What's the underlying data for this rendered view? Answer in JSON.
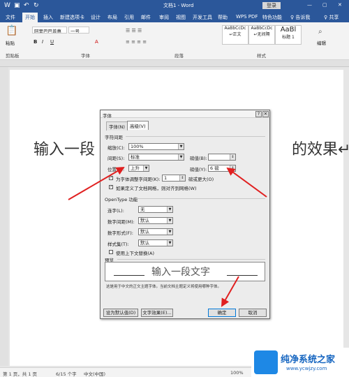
{
  "titlebar": {
    "title": "文档1 - Word",
    "login": "登录",
    "close": "✕",
    "minimize": "—",
    "restore": "▢"
  },
  "tabs": [
    "文件",
    "开始",
    "插入",
    "新建选项卡",
    "设计",
    "布局",
    "引用",
    "邮件",
    "审阅",
    "视图",
    "开发工具",
    "帮助",
    "WPS PDF",
    "特色功能",
    "♀ 告诉我",
    "♀ 共享"
  ],
  "ribbon": {
    "paste": "粘贴",
    "font_name": "阿里巴巴普惠",
    "font_size": "一号",
    "clipboard": "剪贴板",
    "font": "字体",
    "paragraph": "段落",
    "styles": "样式",
    "edit": "编辑",
    "style_items": [
      {
        "preview": "AaBbCcDc",
        "name": "↵正文"
      },
      {
        "preview": "AaBbCcDc",
        "name": "↵无间隔"
      },
      {
        "preview": "AaBl",
        "name": "标题 1"
      }
    ]
  },
  "document": {
    "text_left": "输入一段",
    "text_right": "的效果↵"
  },
  "status": {
    "page": "第 1 页，共 1 页",
    "words": "6/15 个字",
    "lang": "中文(中国)",
    "zoom": "100%"
  },
  "dialog": {
    "title": "字体",
    "help": "?",
    "close": "✕",
    "tab_font": "字体(N)",
    "tab_advanced": "高级(V)",
    "spacing_section": "字符间距",
    "scale_label": "缩放(C):",
    "scale_value": "100%",
    "spacing_label": "间距(S):",
    "spacing_value": "标准",
    "spacing_by_label": "磅值(B):",
    "spacing_by_value": "",
    "position_label": "位置(P):",
    "position_value": "上升",
    "position_by_label": "磅值(Y):",
    "position_by_value": "6 磅",
    "kerning_label": "为字体调整字间距(K):",
    "kerning_value": "1",
    "kerning_suffix": "磅或更大(O)",
    "grid_label": "如果定义了文档网格，则对齐到网格(W)",
    "opentype_section": "OpenType 功能",
    "ligature_label": "连字(L):",
    "ligature_value": "无",
    "numspacing_label": "数字间距(M):",
    "numspacing_value": "默认",
    "numform_label": "数字形式(F):",
    "numform_value": "默认",
    "styleset_label": "样式集(T):",
    "styleset_value": "默认",
    "contextual_label": "使用上下文替换(A)",
    "preview_section": "预览",
    "preview_text": "输入一段文字",
    "preview_note": "这是用于中文的正文主题字体。当前文档主题定义将使用哪种字体。",
    "set_default": "设为默认值(D)",
    "text_effects": "文字效果(E)...",
    "ok": "确定",
    "cancel": "取消"
  },
  "colors": {
    "accent": "#2b579a",
    "arrow": "#e02020"
  },
  "watermark": {
    "brand": "纯净系统之家",
    "url": "www.ycwjzy.com"
  }
}
